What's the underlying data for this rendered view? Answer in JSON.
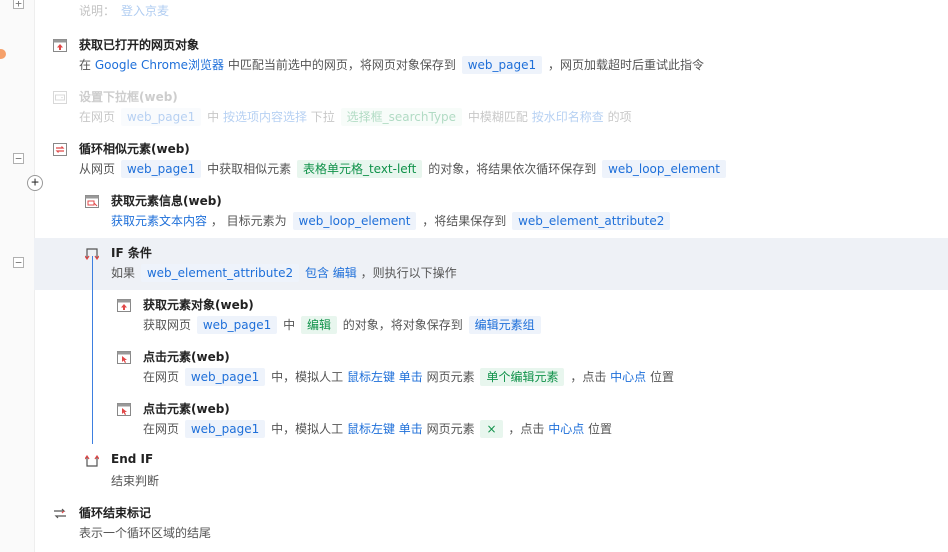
{
  "top_partial": {
    "label": "说明：",
    "value": "登入京麦"
  },
  "steps": [
    {
      "title": "获取已打开的网页对象",
      "desc": {
        "p1": "在",
        "link1": "Google Chrome浏览器",
        "p2": "中匹配当前选中的网页，将网页对象保存到",
        "tag1": "web_page1",
        "p3": "，网页加载超时后重试此指令"
      }
    },
    {
      "title": "设置下拉框(web)",
      "desc": {
        "p1": "在网页",
        "tag1": "web_page1",
        "p2": "中",
        "link1": "按选项内容选择",
        "p3": "下拉",
        "gtag1": "选择框_searchType",
        "p4": "中模糊匹配",
        "link2": "按水印名称查",
        "p5": "的项"
      }
    },
    {
      "title": "循环相似元素(web)",
      "desc": {
        "p1": "从网页",
        "tag1": "web_page1",
        "p2": "中获取相似元素",
        "gtag1": "表格单元格_text-left",
        "p3": "的对象，将结果依次循环保存到",
        "tag2": "web_loop_element"
      }
    },
    {
      "title": "获取元素信息(web)",
      "desc": {
        "link1": "获取元素文本内容",
        "p1": "， 目标元素为",
        "tag1": "web_loop_element",
        "p2": "，将结果保存到",
        "tag2": "web_element_attribute2"
      }
    },
    {
      "title": "IF 条件",
      "desc": {
        "p1": "如果",
        "tag1": "web_element_attribute2",
        "link1": "包含",
        "link2": "编辑",
        "p2": "，则执行以下操作"
      }
    },
    {
      "title": "获取元素对象(web)",
      "desc": {
        "p1": "获取网页",
        "tag1": "web_page1",
        "p2": "中",
        "gtag1": "编辑",
        "p3": "的对象，将对象保存到",
        "tag2": "编辑元素组"
      }
    },
    {
      "title": "点击元素(web)",
      "desc": {
        "p1": "在网页",
        "tag1": "web_page1",
        "p2": "中，模拟人工",
        "link1": "鼠标左键",
        "link2": "单击",
        "p3": "网页元素",
        "gtag1": "单个编辑元素",
        "p4": "，点击",
        "link3": "中心点",
        "p5": "位置"
      }
    },
    {
      "title": "点击元素(web)",
      "desc": {
        "p1": "在网页",
        "tag1": "web_page1",
        "p2": "中，模拟人工",
        "link1": "鼠标左键",
        "link2": "单击",
        "p3": "网页元素",
        "gtag1": "×",
        "p4": "，点击",
        "link3": "中心点",
        "p5": "位置"
      }
    },
    {
      "title": "End IF",
      "desc": {
        "p1": "结束判断"
      }
    },
    {
      "title": "循环结束标记",
      "desc": {
        "p1": "表示一个循环区域的结尾"
      }
    }
  ],
  "colors": {
    "link": "#1e6fd9",
    "green": "#10924a",
    "highlight": "#eef1f6",
    "branch_line": "#3d7fe0"
  },
  "icons": [
    "browser-get-icon",
    "dropdown-icon",
    "loop-icon",
    "browser-info-icon",
    "if-branch-icon",
    "browser-object-icon",
    "browser-click-icon",
    "end-if-icon",
    "loop-end-icon"
  ]
}
